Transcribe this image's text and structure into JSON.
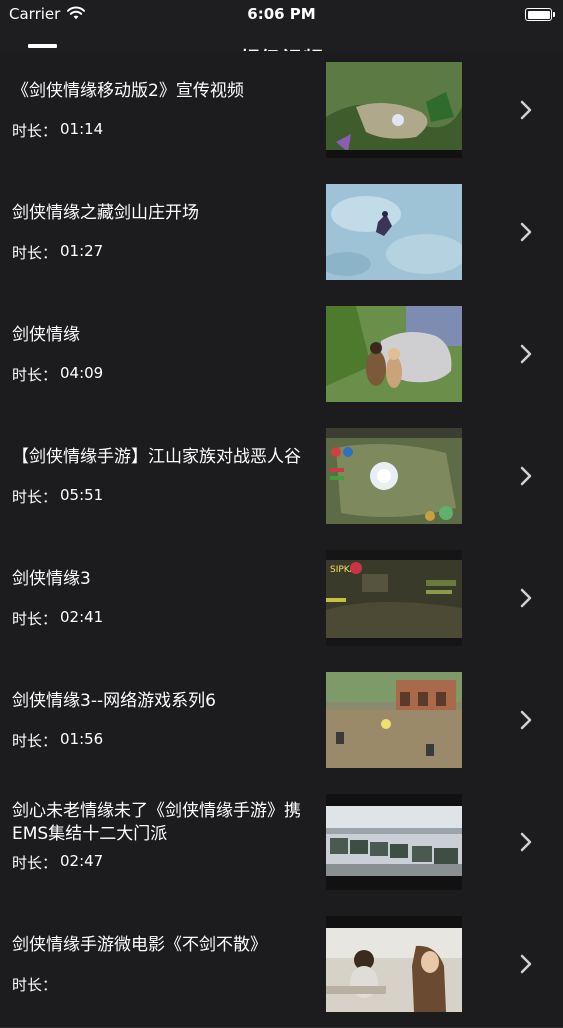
{
  "status_bar": {
    "carrier": "Carrier",
    "time": "6:06 PM",
    "wifi_icon": "wifi-icon",
    "battery_icon": "battery-icon"
  },
  "nav": {
    "title": "超级视频",
    "menu_icon": "hamburger-menu-icon"
  },
  "videos": [
    {
      "title": "《剑侠情缘移动版2》宣传视频",
      "duration_label": "时长：",
      "duration": "01:14"
    },
    {
      "title": "剑侠情缘之藏剑山庄开场",
      "duration_label": "时长：",
      "duration": "01:27"
    },
    {
      "title": "剑侠情缘",
      "duration_label": "时长：",
      "duration": "04:09"
    },
    {
      "title": "【剑侠情缘手游】江山家族对战恶人谷",
      "duration_label": "时长：",
      "duration": "05:51"
    },
    {
      "title": "剑侠情缘3",
      "duration_label": "时长：",
      "duration": "02:41"
    },
    {
      "title": "剑侠情缘3--网络游戏系列6",
      "duration_label": "时长：",
      "duration": "01:56"
    },
    {
      "title": "剑心未老情缘未了《剑侠情缘手游》携EMS集结十二大门派",
      "duration_label": "时长：",
      "duration": "02:47"
    },
    {
      "title": "剑侠情缘手游微电影《不剑不散》",
      "duration_label": "时长：",
      "duration": ""
    }
  ],
  "thumb_overlay_text": "SIPKAS",
  "colors": {
    "background": "#1c1c1e",
    "nav_background": "#1e1e20",
    "separator": "#303033",
    "chevron": "#d0d0d0"
  }
}
